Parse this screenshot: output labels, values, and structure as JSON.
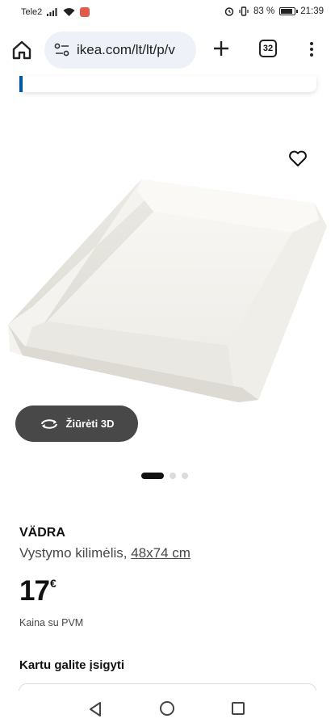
{
  "status_bar": {
    "carrier": "Tele2",
    "battery_percent": "83 %",
    "time": "21:39"
  },
  "browser": {
    "url": "ikea.com/lt/lt/p/v",
    "tab_count": "32"
  },
  "product": {
    "name": "VÄDRA",
    "description": "Vystymo kilimėlis,",
    "size": "48x74 cm",
    "price_integer": "17",
    "price_currency": "€",
    "vat_note": "Kaina su PVM",
    "view_3d_label": "Žiūrėti 3D",
    "carousel": {
      "total": 3,
      "active": 1
    }
  },
  "section": {
    "buy_together_title": "Kartu galite įsigyti"
  },
  "colors": {
    "accent_blue": "#0058a3",
    "button_dark": "#484848",
    "notification": "#e25b4a"
  }
}
